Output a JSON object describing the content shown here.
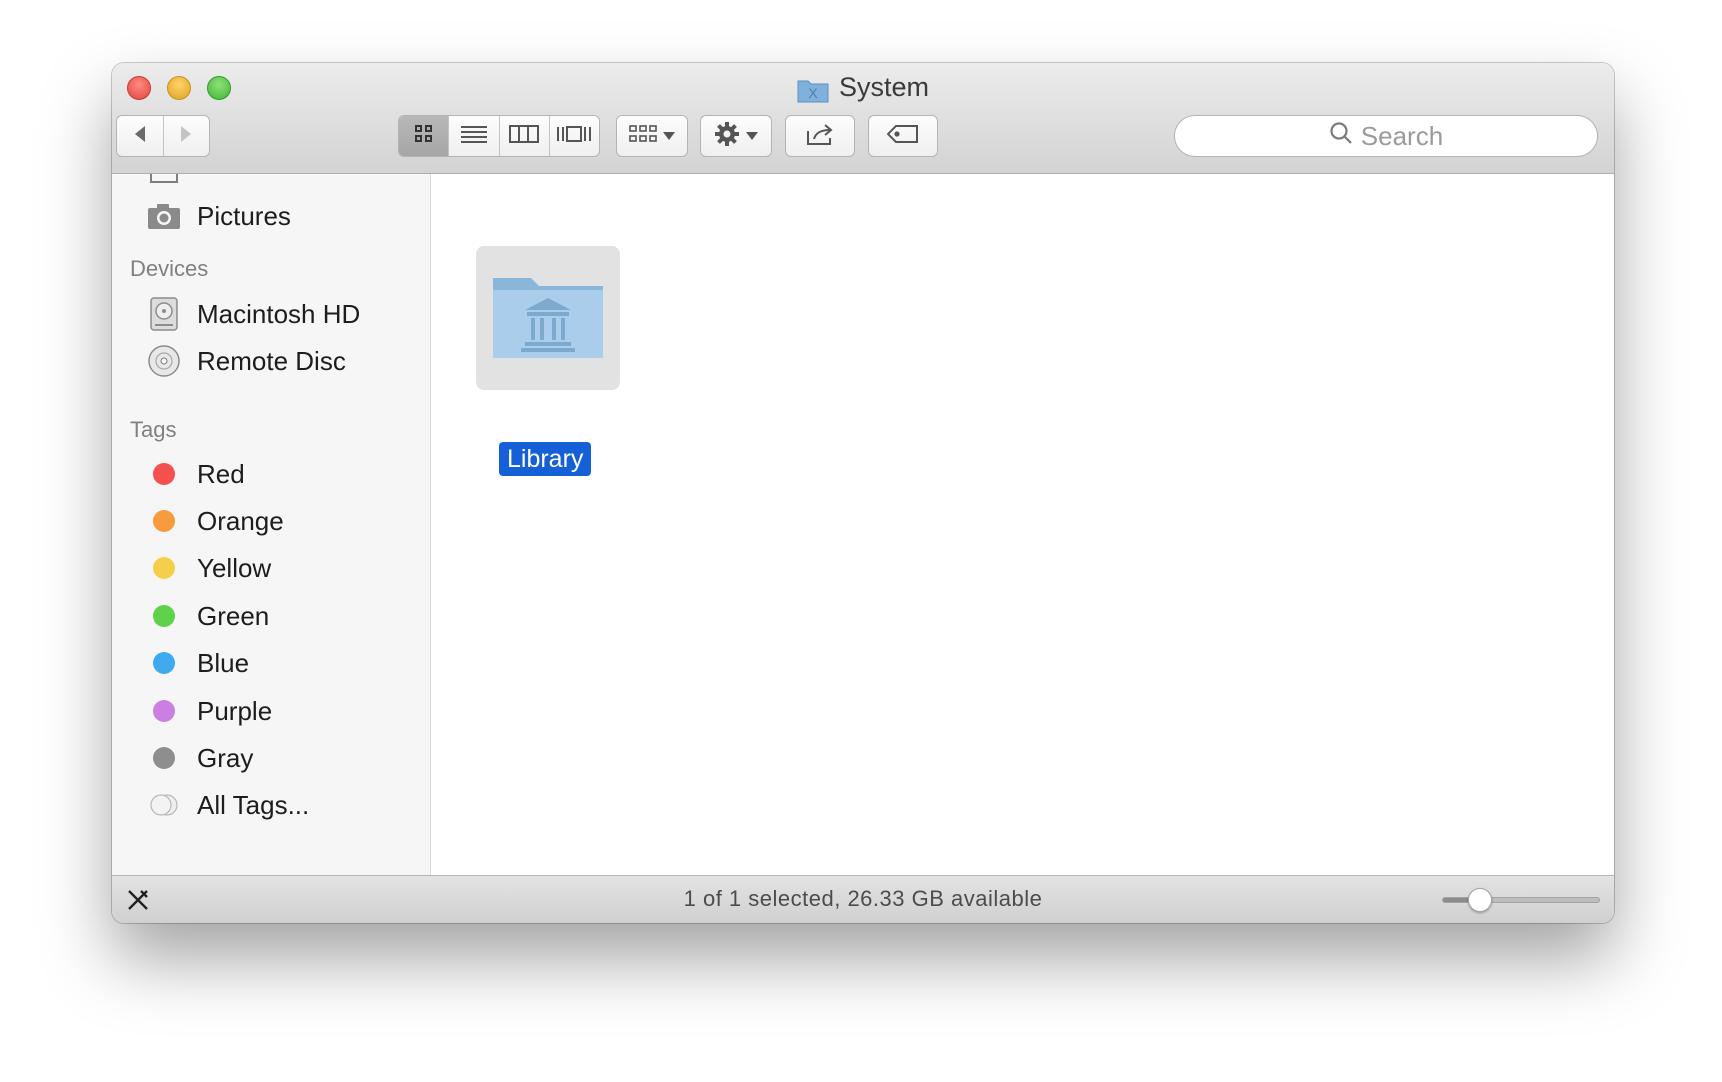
{
  "window": {
    "title": "System"
  },
  "toolbar": {
    "back_icon": "chevron-left-icon",
    "forward_icon": "chevron-right-icon",
    "view_modes": [
      "icon-view",
      "list-view",
      "column-view",
      "cover-flow-view"
    ],
    "active_view": "icon-view",
    "search_placeholder": "Search"
  },
  "sidebar": {
    "favorites_partial": "Pictures",
    "devices_header": "Devices",
    "devices": [
      {
        "label": "Macintosh HD",
        "icon": "hard-drive-icon"
      },
      {
        "label": "Remote Disc",
        "icon": "disc-icon"
      }
    ],
    "tags_header": "Tags",
    "tags": [
      {
        "label": "Red",
        "color": "#f4504d"
      },
      {
        "label": "Orange",
        "color": "#f79b3c"
      },
      {
        "label": "Yellow",
        "color": "#f6cf4a"
      },
      {
        "label": "Green",
        "color": "#5fd14b"
      },
      {
        "label": "Blue",
        "color": "#3faaf0"
      },
      {
        "label": "Purple",
        "color": "#cb7fe0"
      },
      {
        "label": "Gray",
        "color": "#8e8e8e"
      },
      {
        "label": "All Tags..."
      }
    ]
  },
  "content": {
    "items": [
      {
        "label": "Library",
        "selected": true,
        "icon": "library-folder-icon"
      }
    ]
  },
  "status": {
    "text": "1 of 1 selected, 26.33 GB available",
    "zoom_level": 0.24
  },
  "colors": {
    "selection": "#1560d6"
  }
}
